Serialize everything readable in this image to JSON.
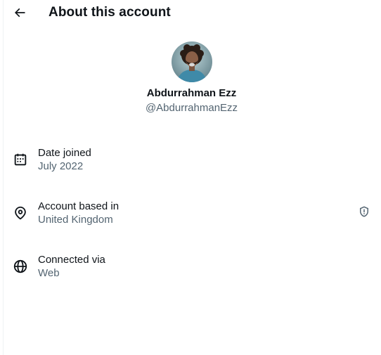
{
  "header": {
    "title": "About this account",
    "back_icon": "arrow-left-icon"
  },
  "profile": {
    "display_name": "Abdurrahman Ezz",
    "handle": "@AbdurrahmanEzz"
  },
  "details": [
    {
      "label": "Date joined",
      "value": "July 2022",
      "icon": "calendar-icon"
    },
    {
      "label": "Account based in",
      "value": "United Kingdom",
      "icon": "location-pin-icon",
      "badge_icon": "shield-alert-icon"
    },
    {
      "label": "Connected via",
      "value": "Web",
      "icon": "globe-icon"
    }
  ],
  "colors": {
    "text_primary": "#0f1419",
    "text_secondary": "#536471",
    "background": "#ffffff"
  }
}
